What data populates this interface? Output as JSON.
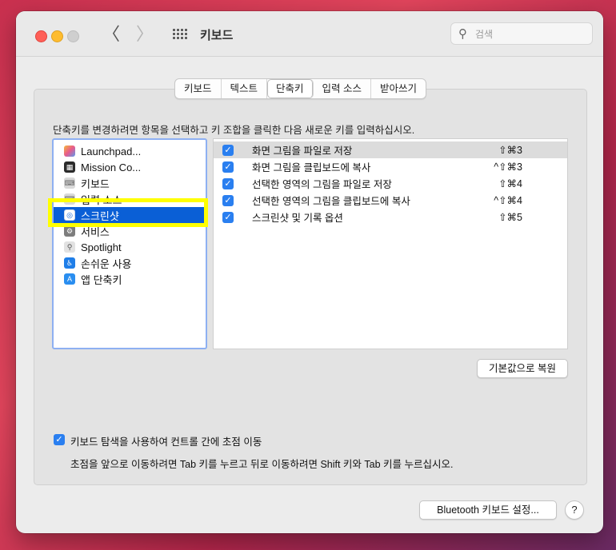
{
  "window": {
    "title": "키보드"
  },
  "toolbar": {
    "back": "〈",
    "forward": "〉"
  },
  "search": {
    "placeholder": "검색",
    "value": ""
  },
  "tabs": [
    {
      "label": "키보드",
      "selected": false
    },
    {
      "label": "텍스트",
      "selected": false
    },
    {
      "label": "단축키",
      "selected": true
    },
    {
      "label": "입력 소스",
      "selected": false
    },
    {
      "label": "받아쓰기",
      "selected": false
    }
  ],
  "instructions": "단축키를 변경하려면 항목을 선택하고 키 조합을 클릭한 다음 새로운 키를 입력하십시오.",
  "categories": [
    {
      "label": "Launchpad...",
      "icon": "launchpad-icon"
    },
    {
      "label": "Mission Co...",
      "icon": "mission-control-icon"
    },
    {
      "label": "키보드",
      "icon": "keyboard-icon"
    },
    {
      "label": "입력 소스",
      "icon": "input-sources-icon"
    },
    {
      "label": "스크린샷",
      "icon": "screenshot-icon",
      "selected": true
    },
    {
      "label": "서비스",
      "icon": "services-icon"
    },
    {
      "label": "Spotlight",
      "icon": "spotlight-icon"
    },
    {
      "label": "손쉬운 사용",
      "icon": "accessibility-icon"
    },
    {
      "label": "앱 단축키",
      "icon": "app-shortcuts-icon"
    }
  ],
  "shortcuts": [
    {
      "label": "화면 그림을 파일로 저장",
      "key": "⇧⌘3",
      "checked": true,
      "selected": true
    },
    {
      "label": "화면 그림을 클립보드에 복사",
      "key": "^⇧⌘3",
      "checked": true
    },
    {
      "label": "선택한 영역의 그림을 파일로 저장",
      "key": "⇧⌘4",
      "checked": true
    },
    {
      "label": "선택한 영역의 그림을 클립보드에 복사",
      "key": "^⇧⌘4",
      "checked": true
    },
    {
      "label": "스크린샷 및 기록 옵션",
      "key": "⇧⌘5",
      "checked": true
    }
  ],
  "buttons": {
    "restore": "기본값으로 복원",
    "bluetooth": "Bluetooth 키보드 설정...",
    "help": "?"
  },
  "keyboard_nav": {
    "label": "키보드 탐색을 사용하여 컨트롤 간에 초점 이동",
    "note": "초점을 앞으로 이동하려면 Tab 키를 누르고 뒤로 이동하려면 Shift 키와 Tab 키를 누르십시오.",
    "checked": true
  },
  "colors": {
    "accent": "#0a5fd6",
    "checkbox": "#2a7ff0",
    "highlight": "#ffff00"
  }
}
